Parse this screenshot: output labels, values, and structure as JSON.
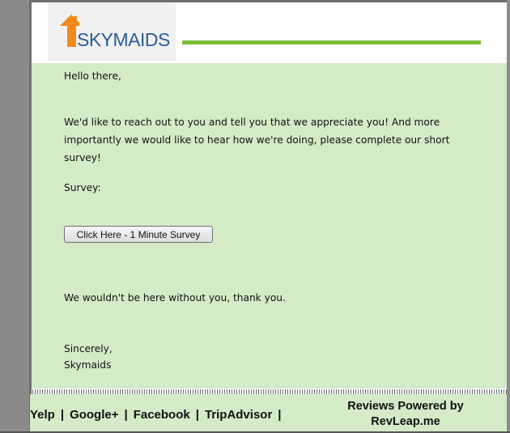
{
  "header": {
    "logo_text": "SKYMAIDS",
    "logo_icon": "house-icon",
    "accent_color": "#7dbb3d"
  },
  "body": {
    "greeting": "Hello there,",
    "message": "We'd like to reach out to you and tell you that we appreciate you! And more importantly we would like to hear how we're doing, please complete our short survey!",
    "survey_label": "Survey:",
    "survey_button_label": "Click Here - 1 Minute Survey",
    "thanks": "We wouldn't be here without you, thank you.",
    "closing": "Sincerely,",
    "signature": "Skymaids",
    "background_color": "#d4ebc8"
  },
  "footer": {
    "links": [
      "Yelp",
      "Google+",
      "Facebook",
      "TripAdvisor"
    ],
    "separator": "|",
    "powered_by_line1": "Reviews Powered by",
    "powered_by_line2": "RevLeap.me"
  }
}
